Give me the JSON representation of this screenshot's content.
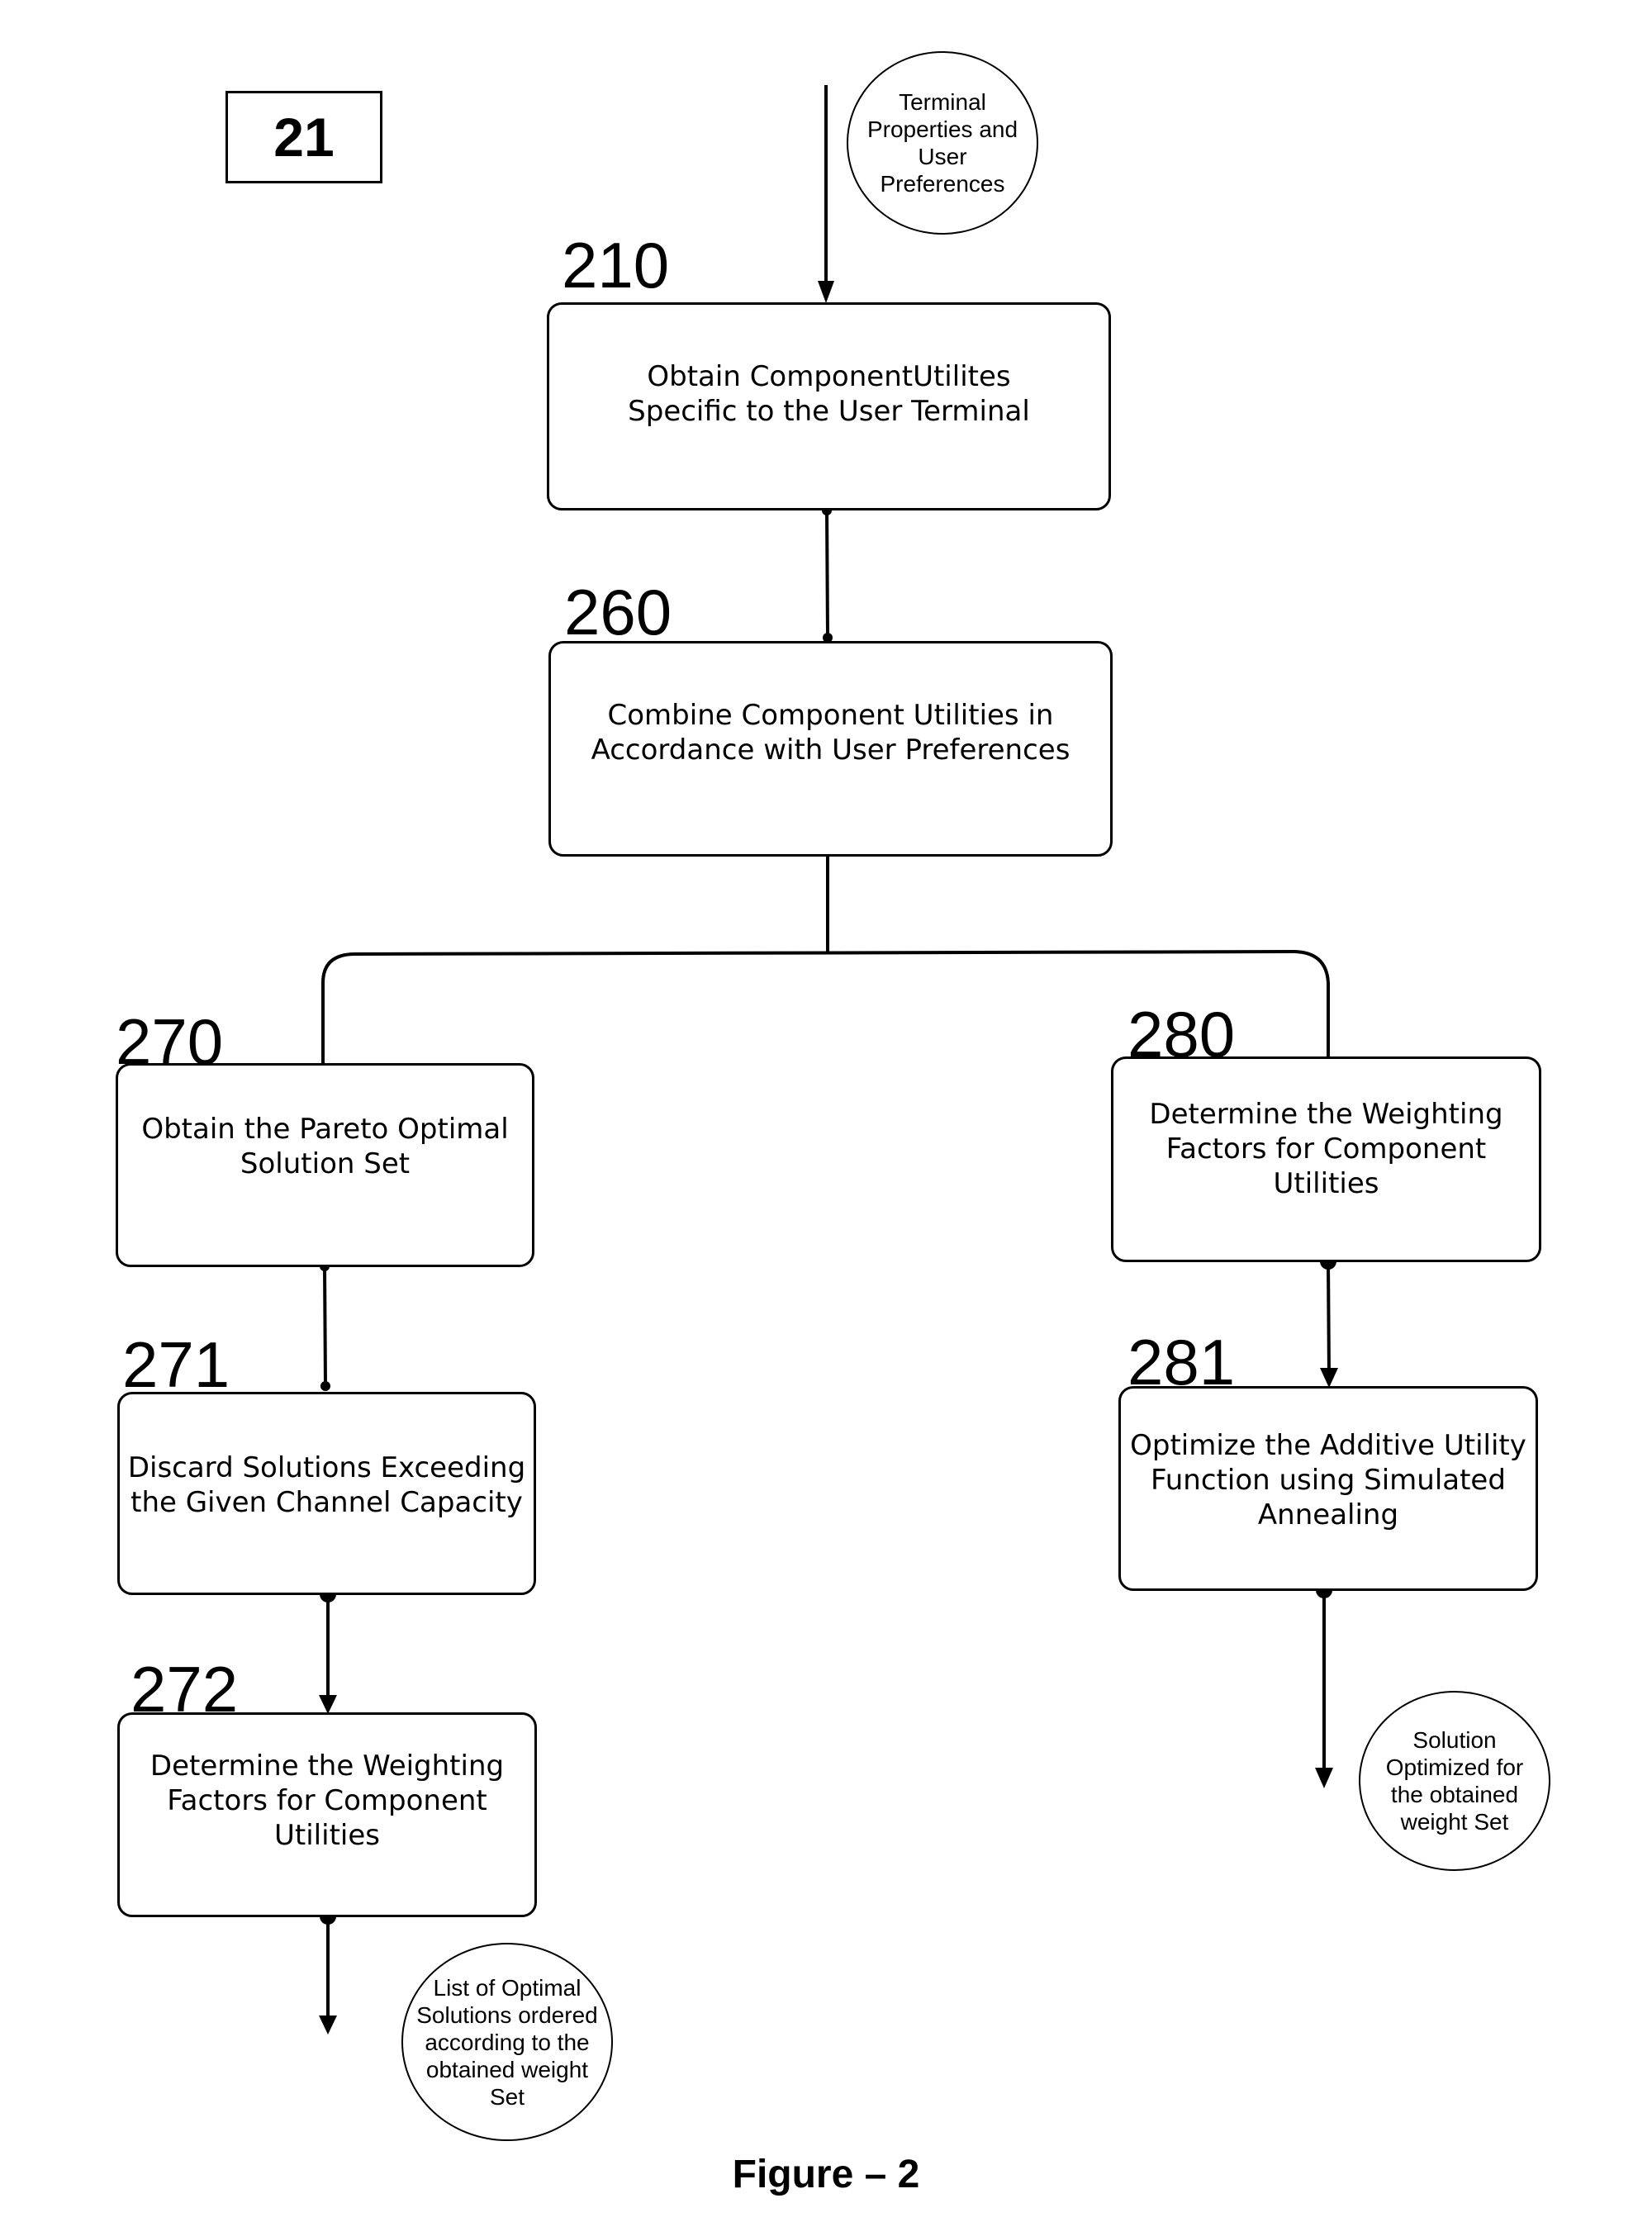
{
  "figure": {
    "id_label": "21",
    "caption": "Figure – 2"
  },
  "inputs": {
    "terminal_properties": "Terminal\nProperties and\nUser\nPreferences"
  },
  "steps": [
    {
      "number": "210",
      "text": "Obtain ComponentUtilites\nSpecific to the User Terminal"
    },
    {
      "number": "260",
      "text": "Combine Component Utilities in\nAccordance with  User Preferences"
    },
    {
      "number": "270",
      "text": "Obtain the Pareto Optimal\nSolution Set"
    },
    {
      "number": "271",
      "text": "Discard Solutions Exceeding\nthe Given Channel Capacity"
    },
    {
      "number": "272",
      "text": "Determine the Weighting\nFactors for  Component\nUtilities"
    },
    {
      "number": "280",
      "text": "Determine the Weighting\nFactors for  Component\nUtilities"
    },
    {
      "number": "281",
      "text": "Optimize the Additive Utility\nFunction using  Simulated\nAnnealing"
    }
  ],
  "outputs": {
    "left": "List of Optimal\nSolutions ordered\naccording to the\nobtained weight\nSet",
    "right": "Solution\nOptimized  for\nthe obtained\nweight Set"
  }
}
